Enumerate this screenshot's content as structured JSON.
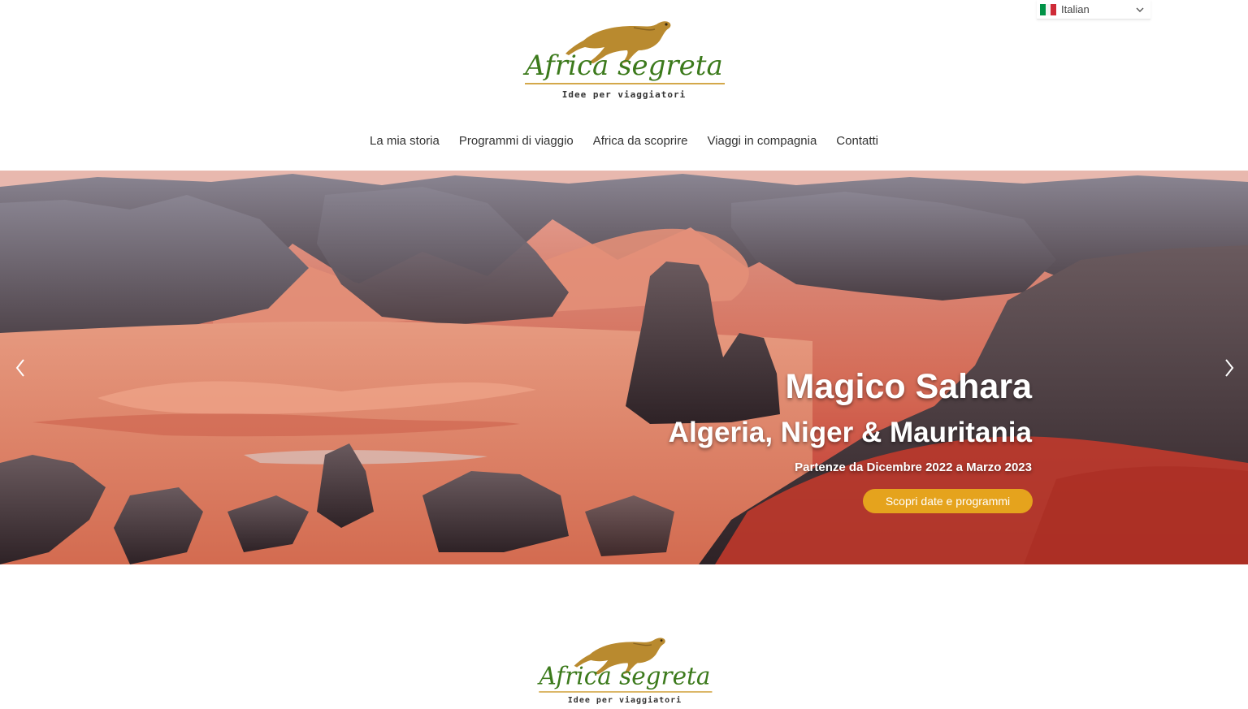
{
  "language_selector": {
    "label": "Italian",
    "flag_colors": [
      "#009246",
      "#ffffff",
      "#ce2b37"
    ]
  },
  "brand": {
    "name": "Africa segreta",
    "tagline": "Idee per viaggiatori",
    "colors": {
      "green": "#3c7a1c",
      "gold": "#d4a84a",
      "cheetah": "#b98a2f"
    }
  },
  "nav": {
    "items": [
      {
        "label": "La mia storia"
      },
      {
        "label": "Programmi di viaggio"
      },
      {
        "label": "Africa da scoprire"
      },
      {
        "label": "Viaggi in compagnia"
      },
      {
        "label": "Contatti"
      }
    ]
  },
  "hero": {
    "title": "Magico Sahara",
    "subtitle": "Algeria, Niger & Mauritania",
    "dates": "Partenze da Dicembre 2022 a Marzo 2023",
    "cta": "Scopri date e programmi",
    "accent_color": "#e5a31d",
    "prev_icon": "chevron-left-icon",
    "next_icon": "chevron-right-icon"
  }
}
